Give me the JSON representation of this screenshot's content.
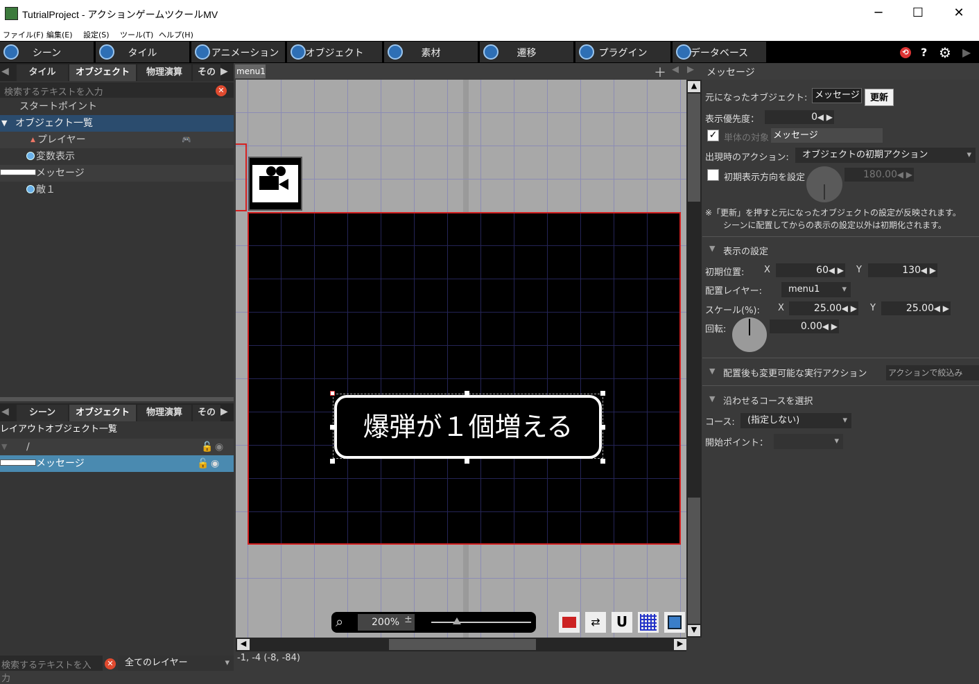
{
  "window": {
    "title": "TutrialProject - アクションゲームツクールMV",
    "min": "─",
    "max": "☐",
    "close": "✕"
  },
  "menu": [
    "ファイル(F)",
    "編集(E)",
    "設定(S)",
    "ツール(T)",
    "ヘルプ(H)"
  ],
  "toolbar": [
    "シーン",
    "タイル",
    "アニメーション",
    "オブジェクト",
    "素材",
    "遷移",
    "プラグイン",
    "データベース"
  ],
  "toolbar_right": {
    "help": "?",
    "gear": "⚙",
    "play": "▶",
    "back": "⟲"
  },
  "left_top": {
    "tabs": [
      "タイル",
      "オブジェクト",
      "物理演算",
      "その"
    ],
    "search_placeholder": "検索するテキストを入力",
    "items": [
      "スタートポイント",
      "オブジェクト一覧",
      "プレイヤー",
      "変数表示",
      "メッセージ",
      "敵１"
    ]
  },
  "left_bottom": {
    "tabs": [
      "シーン",
      "オブジェクト",
      "物理演算",
      "その"
    ],
    "header": "レイアウトオブジェクト一覧",
    "items": [
      "/",
      "メッセージ"
    ],
    "search_placeholder": "検索するテキストを入力",
    "layer": "全てのレイヤー"
  },
  "center": {
    "tab": "menu1",
    "message_text": "爆弾が１個増える",
    "zoom": "200%",
    "zoom_pm": "±",
    "coords": "-1, -4 (-8, -84)"
  },
  "right": {
    "title": "メッセージ",
    "origin_label": "元になったオブジェクト:",
    "origin_value": "メッセージ",
    "update_btn": "更新",
    "priority_label": "表示優先度：",
    "priority_value": "0",
    "single_label": "単体の対象",
    "single_value": "メッセージ",
    "appear_label": "出現時のアクション:",
    "appear_value": "オブジェクトの初期アクション",
    "dir_label": "初期表示方向を設定",
    "dir_value": "180.00",
    "note1": "※「更新」を押すと元になったオブジェクトの設定が反映されます。",
    "note2": "シーンに配置してからの表示の設定以外は初期化されます。",
    "display_section": "表示の設定",
    "pos_label": "初期位置:",
    "x_label": "X",
    "y_label": "Y",
    "pos_x": "60",
    "pos_y": "130",
    "layer_label": "配置レイヤー:",
    "layer_value": "menu1",
    "scale_label": "スケール(%):",
    "scale_x": "25.00",
    "scale_y": "25.00",
    "rot_label": "回転:",
    "rot_value": "0.00",
    "actions_section": "配置後も変更可能な実行アクション",
    "actions_filter": "アクションで絞込み",
    "course_section": "沿わせるコースを選択",
    "course_label": "コース:",
    "course_value": "(指定しない)",
    "start_label": "開始ポイント："
  }
}
